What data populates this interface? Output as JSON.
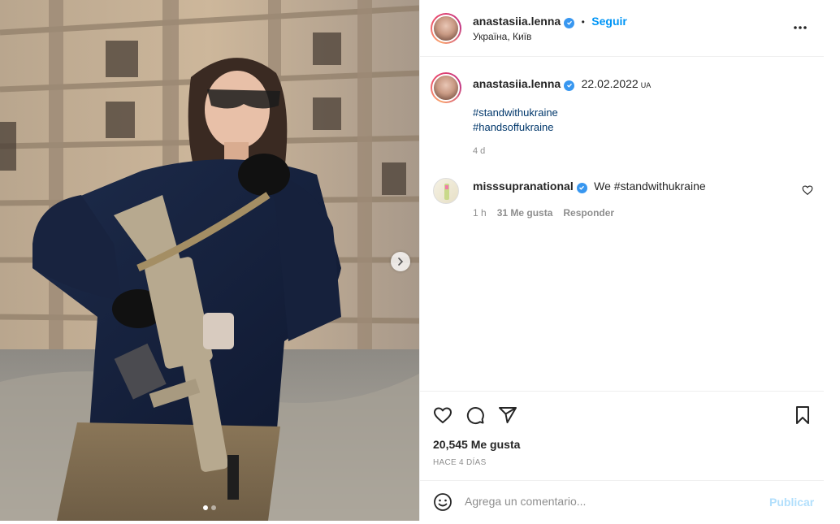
{
  "post": {
    "username": "anastasiia.lenna",
    "follow_label": "Seguir",
    "location": "Україна, Київ",
    "caption_date": "22.02.2022",
    "caption_flag": "UA",
    "hashtags": [
      "#standwithukraine",
      "#handsoffukraine"
    ],
    "caption_age": "4 d",
    "image_count": 2,
    "active_image": 1
  },
  "comments": [
    {
      "username": "misssupranational",
      "text": "We #standwithukraine",
      "age": "1 h",
      "likes": "31 Me gusta",
      "reply_label": "Responder"
    }
  ],
  "engagement": {
    "likes_label": "20,545 Me gusta",
    "time_ago": "HACE 4 DÍAS"
  },
  "comment_box": {
    "placeholder": "Agrega un comentario...",
    "publish_label": "Publicar"
  },
  "icons": {
    "more": "more-icon",
    "like": "heart-icon",
    "comment": "comment-icon",
    "share": "share-icon",
    "save": "bookmark-icon",
    "emoji": "emoji-icon",
    "next": "chevron-right-icon"
  },
  "colors": {
    "link_blue": "#0095f6",
    "hashtag_blue": "#00376b",
    "verified_blue": "#3897f0",
    "muted_gray": "#8e8e8e",
    "publish_disabled": "#b2dffc"
  }
}
